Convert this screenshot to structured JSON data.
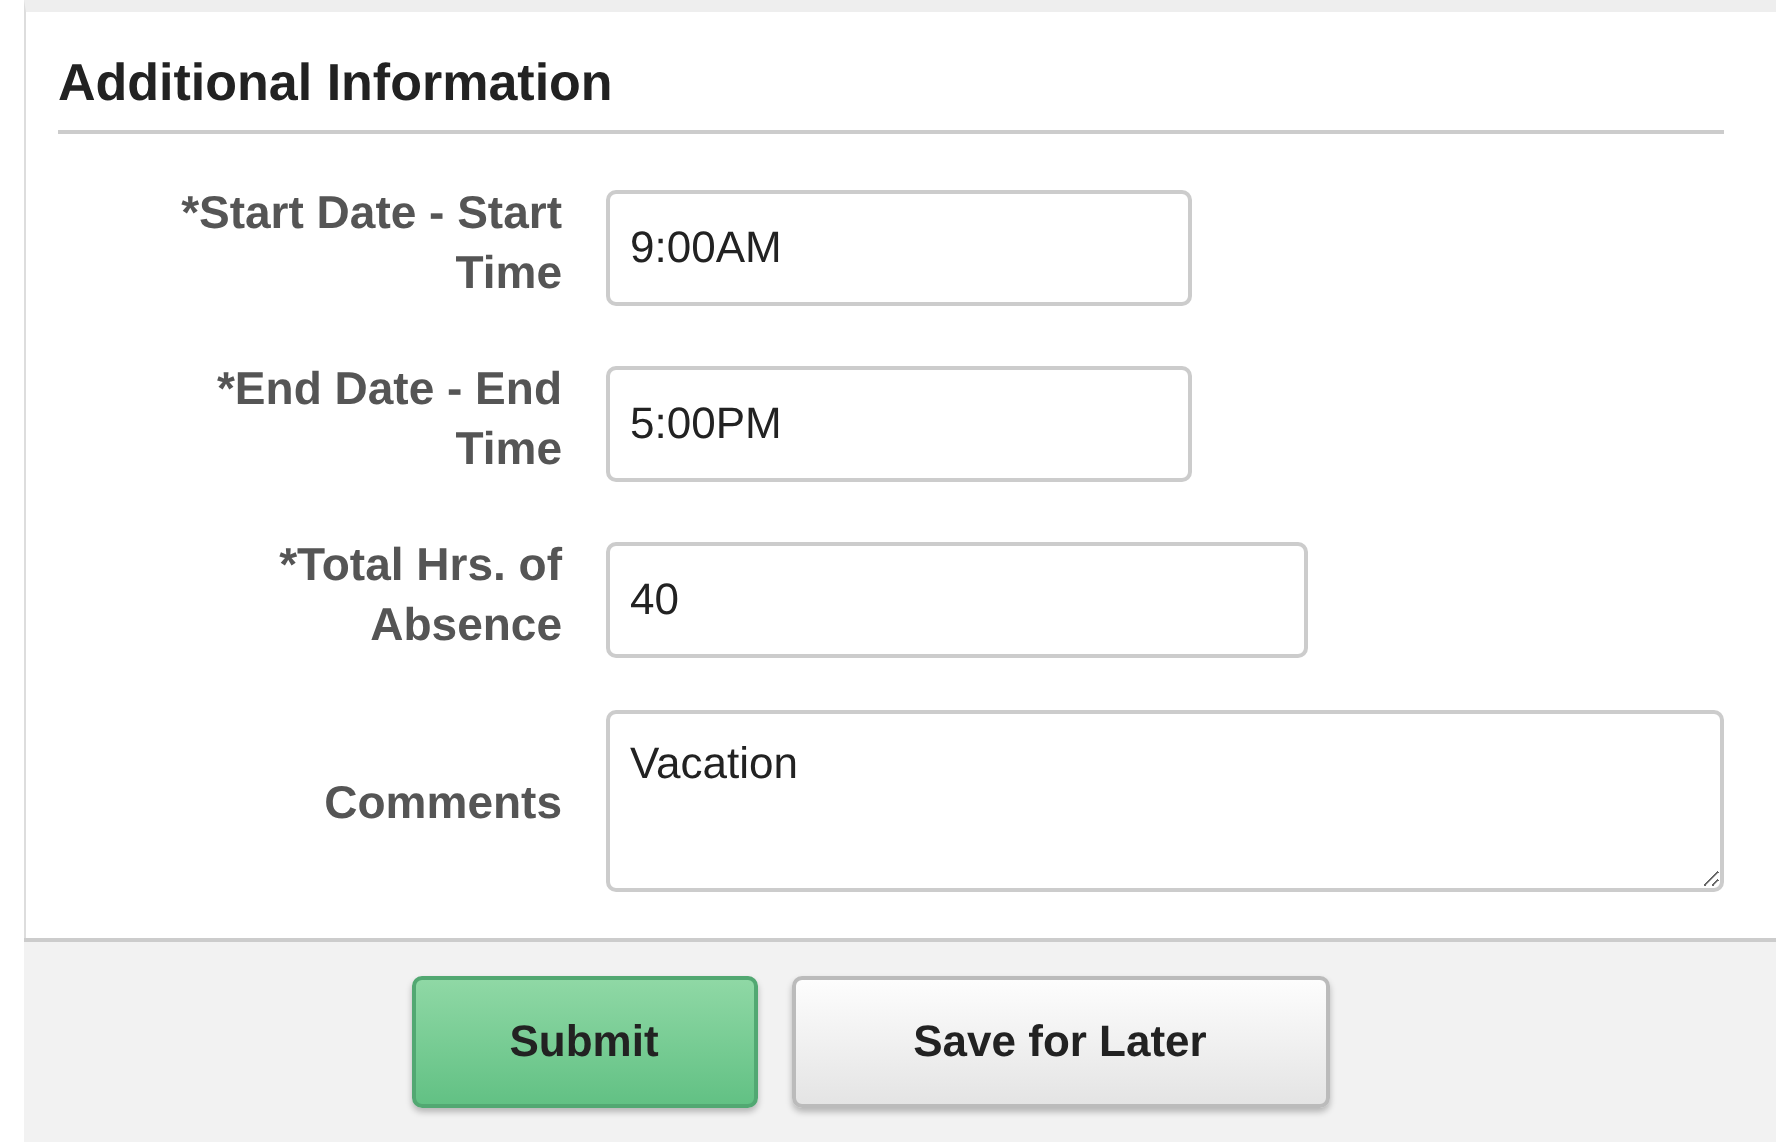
{
  "section": {
    "title": "Additional Information"
  },
  "fields": [
    {
      "kind": "input",
      "label": "*Start Date - Start Time",
      "value": "9:00AM"
    },
    {
      "kind": "input",
      "label": "*End Date - End Time",
      "value": "5:00PM"
    },
    {
      "kind": "input",
      "label": "*Total Hrs. of Absence",
      "value": "40"
    },
    {
      "kind": "textarea",
      "label": "Comments",
      "value": "Vacation"
    }
  ],
  "buttons": [
    {
      "label": "Submit",
      "kind": "primary"
    },
    {
      "label": "Save for Later",
      "kind": "secondary"
    }
  ]
}
